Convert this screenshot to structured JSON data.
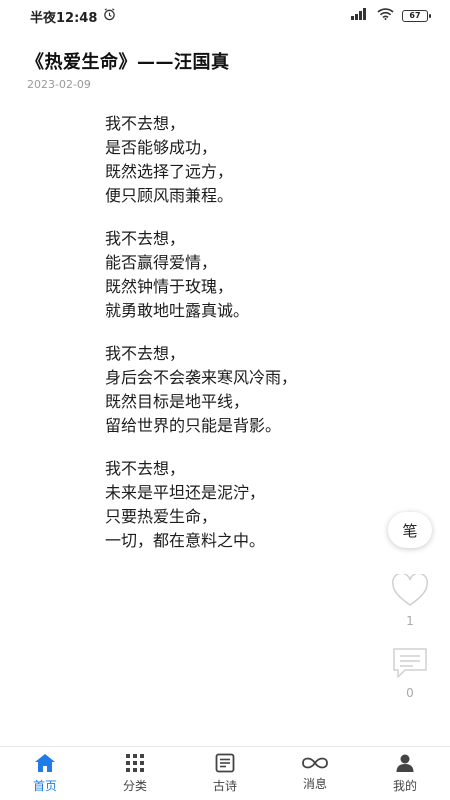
{
  "status_bar": {
    "time": "半夜12:48",
    "battery": "67"
  },
  "article": {
    "title": "《热爱生命》——汪国真",
    "date": "2023-02-09",
    "stanzas": [
      [
        "我不去想，",
        "是否能够成功，",
        "既然选择了远方，",
        "便只顾风雨兼程。"
      ],
      [
        "我不去想，",
        "能否赢得爱情，",
        "既然钟情于玫瑰，",
        "就勇敢地吐露真诚。"
      ],
      [
        "我不去想，",
        "身后会不会袭来寒风冷雨，",
        "既然目标是地平线，",
        "留给世界的只能是背影。"
      ],
      [
        "我不去想，",
        "未来是平坦还是泥泞，",
        "只要热爱生命，",
        "一切，都在意料之中。"
      ]
    ]
  },
  "side_actions": {
    "pen_label": "笔",
    "like_count": "1",
    "comment_count": "0"
  },
  "bottom_nav": {
    "items": [
      {
        "label": "首页",
        "icon": "home-icon",
        "active": true
      },
      {
        "label": "分类",
        "icon": "grid-icon",
        "active": false
      },
      {
        "label": "古诗",
        "icon": "document-icon",
        "active": false
      },
      {
        "label": "消息",
        "icon": "infinity-icon",
        "active": false
      },
      {
        "label": "我的",
        "icon": "user-icon",
        "active": false
      }
    ],
    "accent_color": "#1e7ce8"
  }
}
